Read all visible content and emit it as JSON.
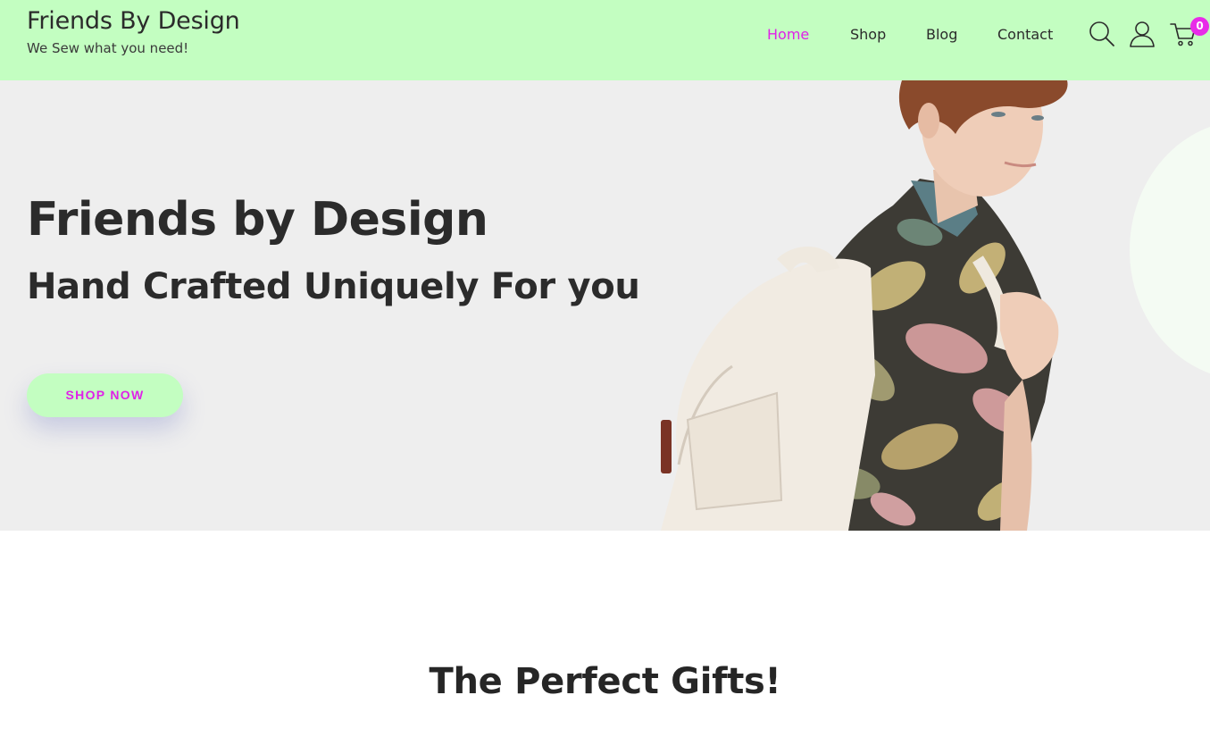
{
  "header": {
    "site_title": "Friends By Design",
    "tagline": "We Sew what you need!",
    "background": "#c3fec1",
    "nav": [
      {
        "label": "Home",
        "active": true
      },
      {
        "label": "Shop",
        "active": false
      },
      {
        "label": "Blog",
        "active": false
      },
      {
        "label": "Contact",
        "active": false
      }
    ],
    "icons": [
      "search-icon",
      "user-icon",
      "cart-icon"
    ],
    "cart_count": "0"
  },
  "hero": {
    "title": "Friends by Design",
    "subtitle": "Hand Crafted Uniquely For you",
    "cta_label": "SHOP NOW"
  },
  "section": {
    "title": "The Perfect Gifts!"
  },
  "colors": {
    "accent": "#e021e8",
    "brand_green": "#c3fec1",
    "hero_bg": "#eeeeee",
    "text": "#2b2b2b"
  }
}
